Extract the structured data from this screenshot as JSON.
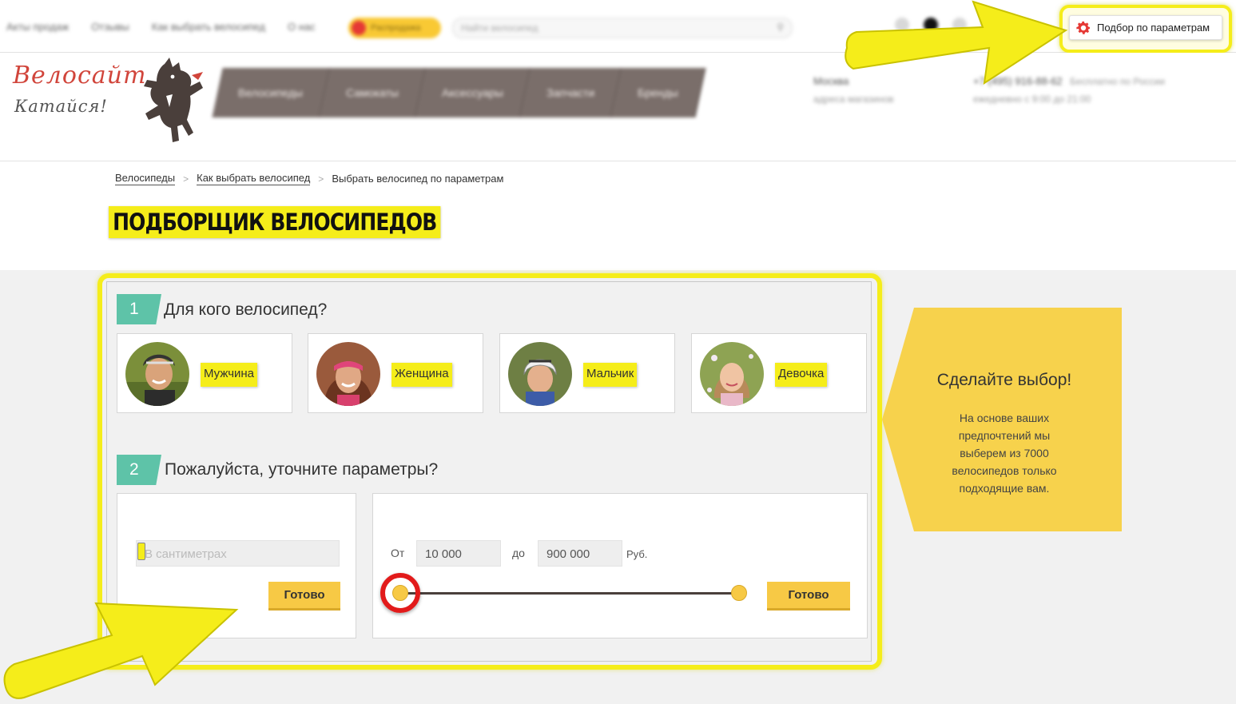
{
  "topbar": {
    "nav": [
      "Акты продаж",
      "Отзывы",
      "Как выбрать велосипед",
      "О нас"
    ],
    "promo_label": "Распродажа",
    "search_placeholder": "Найти велосипед",
    "filter_button_label": "Подбор по параметрам"
  },
  "header": {
    "logo_text": "Велосайт",
    "logo_tagline": "Катайся!",
    "nav": [
      "Велосипеды",
      "Самокаты",
      "Аксессуары",
      "Запчасти",
      "Бренды"
    ],
    "city": "Москва",
    "city_sub": "адреса магазинов",
    "phone": "+7 (495) 916-88-62",
    "phone_sub": "ежедневно с 9:00 до 21:00",
    "phone_extra": "Бесплатно по России"
  },
  "breadcrumbs": [
    {
      "label": "Велосипеды",
      "link": true
    },
    {
      "label": "Как выбрать велосипед",
      "link": true
    },
    {
      "label": "Выбрать велосипед по параметрам",
      "link": false
    }
  ],
  "page_title": "ПОДБОРЩИК ВЕЛОСИПЕДОВ",
  "step1": {
    "number": "1",
    "title": "Для кого велосипед?",
    "options": [
      {
        "label": "Мужчина"
      },
      {
        "label": "Женщина"
      },
      {
        "label": "Мальчик"
      },
      {
        "label": "Девочка"
      }
    ]
  },
  "step2": {
    "number": "2",
    "title": "Пожалуйста, уточните параметры?",
    "height_placeholder": "В сантиметрах",
    "height_done": "Готово",
    "price_from_label": "От",
    "price_from": "10 000",
    "price_to_label": "до",
    "price_to": "900 000",
    "currency": "Руб.",
    "price_done": "Готово"
  },
  "promo": {
    "title": "Сделайте выбор!",
    "text": "На основе ваших предпочтений мы выберем из 7000 велосипедов только подходящие вам."
  },
  "colors": {
    "highlight": "#f5ed1a",
    "accent": "#f7c945",
    "step_badge": "#5ec3a8",
    "logo": "#d1453b",
    "annotation_ring": "#e21b1b"
  }
}
